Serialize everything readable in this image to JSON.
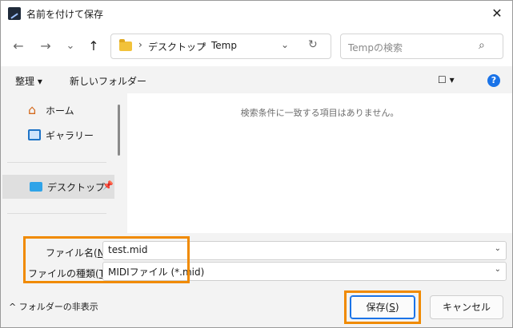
{
  "window": {
    "title": "名前を付けて保存",
    "close_glyph": "✕"
  },
  "nav": {
    "back": "←",
    "forward": "→",
    "recent": "⌄",
    "up": "↑",
    "breadcrumb": [
      "デスクトップ",
      "Temp"
    ],
    "sep": "›",
    "dropdown": "⌄",
    "refresh": "↻",
    "search_placeholder": "Tempの検索",
    "search_glyph": "⌕"
  },
  "toolbar": {
    "organize": "整理 ▾",
    "new_folder": "新しいフォルダー",
    "view": "☐ ▾",
    "help": "?"
  },
  "sidebar": {
    "items": [
      {
        "label": "ホーム",
        "icon": "home-icon"
      },
      {
        "label": "ギャラリー",
        "icon": "gallery-icon"
      },
      {
        "label": "デスクトップ",
        "icon": "desktop-icon",
        "selected": true,
        "pin": "📌"
      }
    ]
  },
  "main": {
    "empty_message": "検索条件に一致する項目はありません。"
  },
  "form": {
    "filename_label_pre": "ファイル名(",
    "filename_label_key": "N",
    "filename_label_post": "):",
    "filename_value": "test.mid",
    "filetype_label_pre": "ファイルの種類(",
    "filetype_label_key": "T",
    "filetype_label_post": "):",
    "filetype_value": "MIDIファイル (*.mid)"
  },
  "footer": {
    "toggle_label": "^ フォルダーの非表示",
    "save_pre": "保存(",
    "save_key": "S",
    "save_post": ")",
    "cancel": "キャンセル"
  },
  "colors": {
    "highlight": "#f08a00",
    "accent": "#1a73e8"
  }
}
